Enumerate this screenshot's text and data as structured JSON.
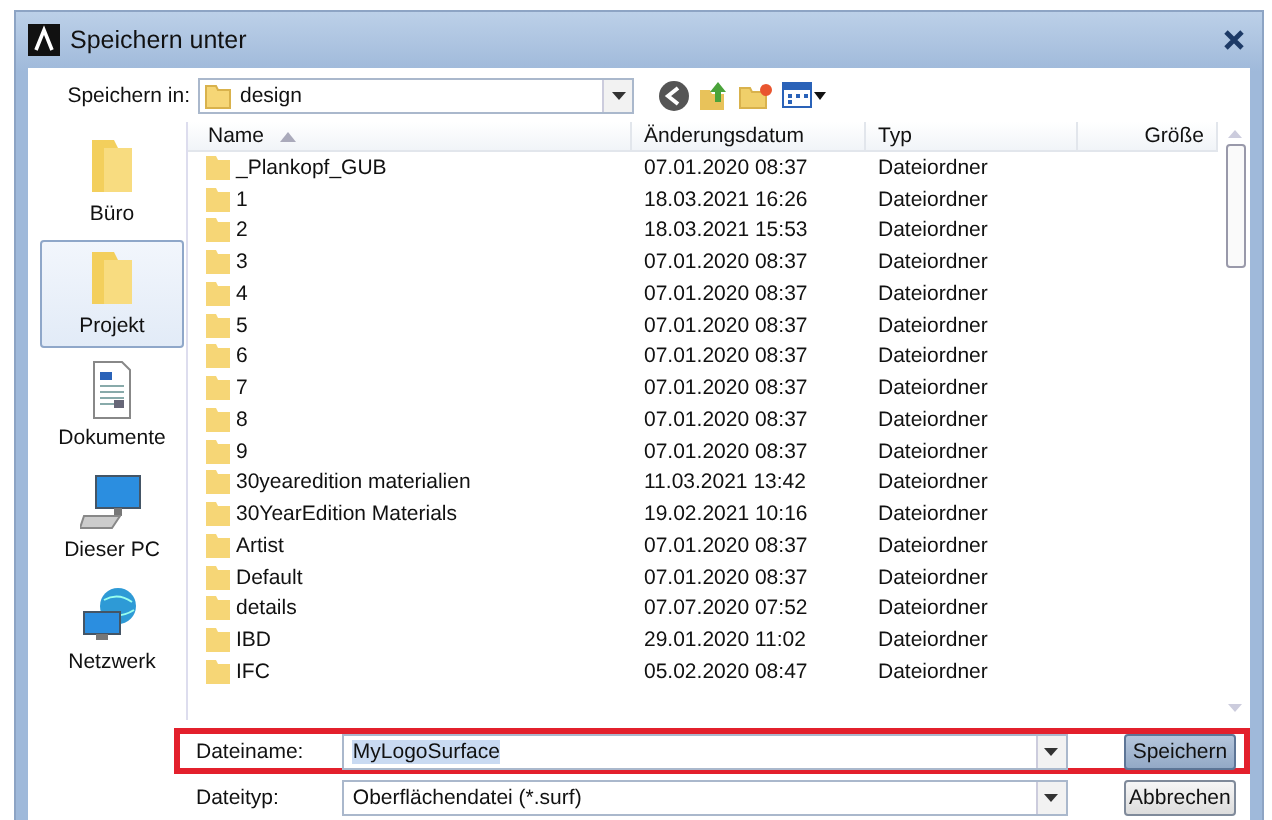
{
  "window": {
    "title": "Speichern unter"
  },
  "save_in": {
    "label": "Speichern in:",
    "value": "design"
  },
  "sidebar": {
    "items": [
      {
        "label": "Büro",
        "kind": "folder",
        "selected": false
      },
      {
        "label": "Projekt",
        "kind": "folder",
        "selected": true
      },
      {
        "label": "Dokumente",
        "kind": "documents",
        "selected": false
      },
      {
        "label": "Dieser PC",
        "kind": "computer",
        "selected": false
      },
      {
        "label": "Netzwerk",
        "kind": "network",
        "selected": false
      }
    ]
  },
  "table": {
    "columns": [
      {
        "label": "Name",
        "sorted": true
      },
      {
        "label": "Änderungsdatum",
        "sorted": false
      },
      {
        "label": "Typ",
        "sorted": false
      },
      {
        "label": "Größe",
        "sorted": false
      }
    ],
    "rows": [
      {
        "name": "_Plankopf_GUB",
        "date": "07.01.2020 08:37",
        "type": "Dateiordner"
      },
      {
        "name": "1",
        "date": "18.03.2021 16:26",
        "type": "Dateiordner"
      },
      {
        "name": "2",
        "date": "18.03.2021 15:53",
        "type": "Dateiordner"
      },
      {
        "name": "3",
        "date": "07.01.2020 08:37",
        "type": "Dateiordner"
      },
      {
        "name": "4",
        "date": "07.01.2020 08:37",
        "type": "Dateiordner"
      },
      {
        "name": "5",
        "date": "07.01.2020 08:37",
        "type": "Dateiordner"
      },
      {
        "name": "6",
        "date": "07.01.2020 08:37",
        "type": "Dateiordner"
      },
      {
        "name": "7",
        "date": "07.01.2020 08:37",
        "type": "Dateiordner"
      },
      {
        "name": "8",
        "date": "07.01.2020 08:37",
        "type": "Dateiordner"
      },
      {
        "name": "9",
        "date": "07.01.2020 08:37",
        "type": "Dateiordner"
      },
      {
        "name": "30yearedition materialien",
        "date": "11.03.2021 13:42",
        "type": "Dateiordner"
      },
      {
        "name": "30YearEdition Materials",
        "date": "19.02.2021 10:16",
        "type": "Dateiordner"
      },
      {
        "name": "Artist",
        "date": "07.01.2020 08:37",
        "type": "Dateiordner"
      },
      {
        "name": "Default",
        "date": "07.01.2020 08:37",
        "type": "Dateiordner"
      },
      {
        "name": "details",
        "date": "07.07.2020 07:52",
        "type": "Dateiordner"
      },
      {
        "name": "IBD",
        "date": "29.01.2020 11:02",
        "type": "Dateiordner"
      },
      {
        "name": "IFC",
        "date": "05.02.2020 08:47",
        "type": "Dateiordner"
      }
    ]
  },
  "filename": {
    "label": "Dateiname:",
    "value": "MyLogoSurface",
    "text_selected": true,
    "highlighted": true
  },
  "filetype": {
    "label": "Dateityp:",
    "value": "Oberflächendatei (*.surf)"
  },
  "buttons": [
    {
      "label": "Speichern",
      "default": true
    },
    {
      "label": "Abbrechen",
      "default": false
    }
  ]
}
